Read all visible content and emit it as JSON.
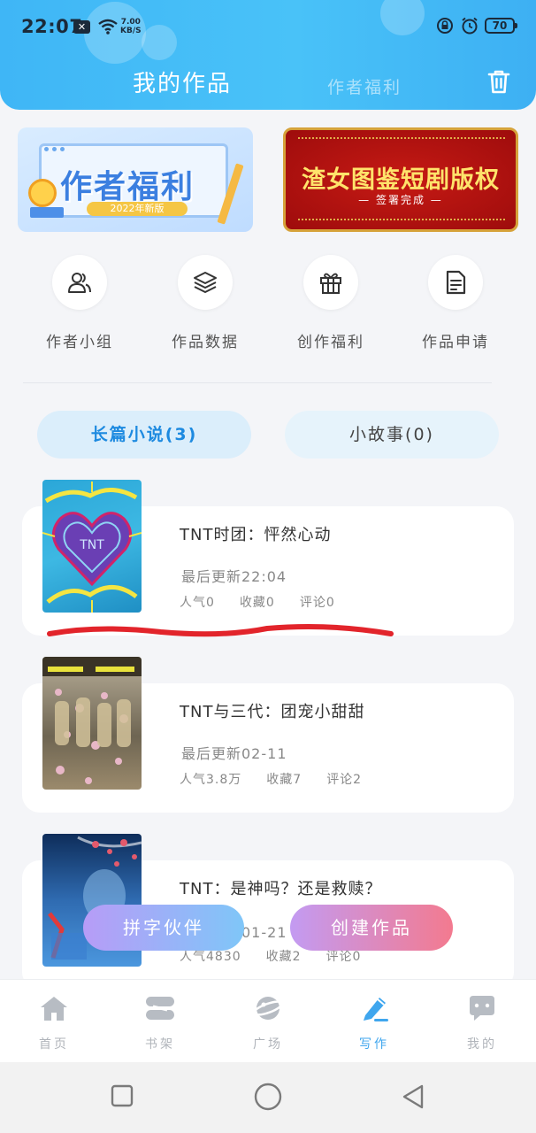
{
  "status_bar": {
    "time": "22:07",
    "network_speed_value": "7.00",
    "network_speed_unit": "KB/S",
    "battery": "70"
  },
  "header": {
    "active_tab": "我的作品",
    "inactive_tab": "作者福利",
    "trash_icon": "trash-icon"
  },
  "banners": [
    {
      "title": "作者福利",
      "tag": "2022年新版"
    },
    {
      "title": "渣女图鉴短剧版权",
      "subtitle": "— 签署完成 —"
    }
  ],
  "quick_entries": [
    {
      "label": "作者小组",
      "icon": "group-icon"
    },
    {
      "label": "作品数据",
      "icon": "layers-icon"
    },
    {
      "label": "创作福利",
      "icon": "gift-icon"
    },
    {
      "label": "作品申请",
      "icon": "document-icon"
    }
  ],
  "filter_tabs": [
    {
      "label": "长篇小说(3)",
      "active": true
    },
    {
      "label": "小故事(0)",
      "active": false
    }
  ],
  "works": [
    {
      "title": "TNT时团：怦然心动",
      "updated": "最后更新22:04",
      "popularity": "人气0",
      "favorites": "收藏0",
      "comments": "评论0"
    },
    {
      "title": "TNT与三代：团宠小甜甜",
      "updated": "最后更新02-11",
      "popularity": "人气3.8万",
      "favorites": "收藏7",
      "comments": "评论2"
    },
    {
      "title": "TNT：是神吗？还是救赎？",
      "updated": "最后更新01-21",
      "popularity": "人气4830",
      "favorites": "收藏2",
      "comments": "评论0"
    }
  ],
  "floating_buttons": {
    "partner": "拼字伙伴",
    "create": "创建作品"
  },
  "bottom_nav": [
    {
      "label": "首页",
      "icon": "home-icon",
      "active": false
    },
    {
      "label": "书架",
      "icon": "bookshelf-icon",
      "active": false
    },
    {
      "label": "广场",
      "icon": "planet-icon",
      "active": false
    },
    {
      "label": "写作",
      "icon": "pen-icon",
      "active": true
    },
    {
      "label": "我的",
      "icon": "chat-bubble-icon",
      "active": false
    }
  ],
  "colors": {
    "header": "#45bdf7",
    "accent": "#3fa6ee",
    "annotation_stroke": "#e2242b"
  }
}
